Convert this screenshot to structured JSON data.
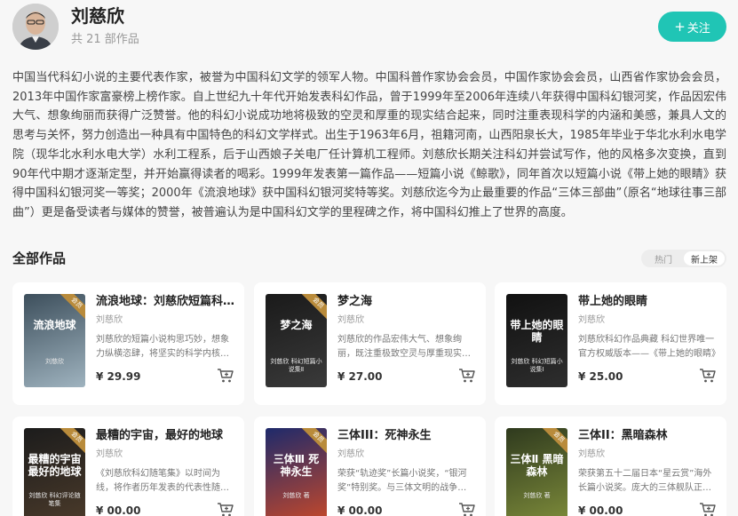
{
  "author": {
    "name": "刘慈欣",
    "works_count": "共 21 部作品",
    "follow_label": "关注",
    "bio": "中国当代科幻小说的主要代表作家，被誉为中国科幻文学的领军人物。中国科普作家协会会员，中国作家协会会员，山西省作家协会会员，2013年中国作家富豪榜上榜作家。自上世纪九十年代开始发表科幻作品，曾于1999年至2006年连续八年获得中国科幻银河奖，作品因宏伟大气、想象绚丽而获得广泛赞誉。他的科幻小说成功地将极致的空灵和厚重的现实结合起来，同时注重表现科学的内涵和美感，兼具人文的思考与关怀，努力创造出一种具有中国特色的科幻文学样式。出生于1963年6月，祖籍河南，山西阳泉长大，1985年毕业于华北水利水电学院（现华北水利水电大学）水利工程系，后于山西娘子关电厂任计算机工程师。刘慈欣长期关注科幻并尝试写作，他的风格多次变换，直到90年代中期才逐渐定型，并开始赢得读者的喝彩。1999年发表第一篇作品——短篇小说《鲸歌》，同年首次以短篇小说《带上她的眼睛》获得中国科幻银河奖一等奖；2000年《流浪地球》获中国科幻银河奖特等奖。刘慈欣迄今为止最重要的作品“三体三部曲”（原名“地球往事三部曲”）更是备受读者与媒体的赞誉，被普遍认为是中国科幻文学的里程碑之作，将中国科幻推上了世界的高度。"
  },
  "works_section": {
    "title": "全部作品",
    "sort_options": [
      "热门",
      "新上架"
    ],
    "active_sort": "新上架"
  },
  "books": [
    {
      "title": "流浪地球：刘慈欣短篇科幻小说集",
      "author": "刘慈欣",
      "desc": "刘慈欣的短篇小说构思巧妙，想象力纵横恣肆，将坚实的科学内核与宏大的人文情怀相结合",
      "price": "¥ 29.99",
      "cover_title": "流浪地球",
      "cover_sub": "刘慈欣",
      "cover_colors": [
        "#3d4f5c",
        "#9fb3bf"
      ],
      "badge": "会员"
    },
    {
      "title": "梦之海",
      "author": "刘慈欣",
      "desc": "刘慈欣的作品宏伟大气、想象绚丽，既注重极致空灵与厚重现实的结合",
      "price": "¥ 27.00",
      "cover_title": "梦之海",
      "cover_sub": "刘慈欣 科幻短篇小说集Ⅱ",
      "cover_colors": [
        "#1a1a1a",
        "#3a3a3a"
      ],
      "badge": "会员"
    },
    {
      "title": "带上她的眼睛",
      "author": "刘慈欣",
      "desc": "刘慈欣科幻作品典藏 科幻世界唯一官方权威版本——《带上她的眼睛》",
      "price": "¥ 25.00",
      "cover_title": "带上她的眼睛",
      "cover_sub": "刘慈欣 科幻短篇小说集Ⅰ",
      "cover_colors": [
        "#111111",
        "#2e2e2e"
      ],
      "badge": ""
    },
    {
      "title": "最糟的宇宙，最好的地球",
      "author": "刘慈欣",
      "desc": "《刘慈欣科幻随笔集》以时间为线，将作者历年发表的代表性随笔收录成集",
      "price": "¥ 00.00",
      "cover_title": "最糟的宇宙 最好的地球",
      "cover_sub": "刘慈欣 科幻评论随笔集",
      "cover_colors": [
        "#1c1c1c",
        "#4a3a2a"
      ],
      "badge": "会员"
    },
    {
      "title": "三体III：死神永生",
      "author": "刘慈欣",
      "desc": "荣获“轨迹奖”长篇小说奖，“银河奖”特别奖。与三体文明的战争使人类首次看到了宇宙黑暗的真相",
      "price": "¥ 00.00",
      "cover_title": "三体Ⅲ 死神永生",
      "cover_sub": "刘慈欣 著",
      "cover_colors": [
        "#1e2a6b",
        "#c3482b"
      ],
      "badge": "会员"
    },
    {
      "title": "三体II：黑暗森林",
      "author": "刘慈欣",
      "desc": "荣获第五十二届日本“星云赏”海外长篇小说奖。庞大的三体舰队正向地球进发",
      "price": "¥ 00.00",
      "cover_title": "三体Ⅱ 黑暗森林",
      "cover_sub": "刘慈欣 著",
      "cover_colors": [
        "#2f3a1e",
        "#7c8a3a"
      ],
      "badge": "会员"
    }
  ]
}
